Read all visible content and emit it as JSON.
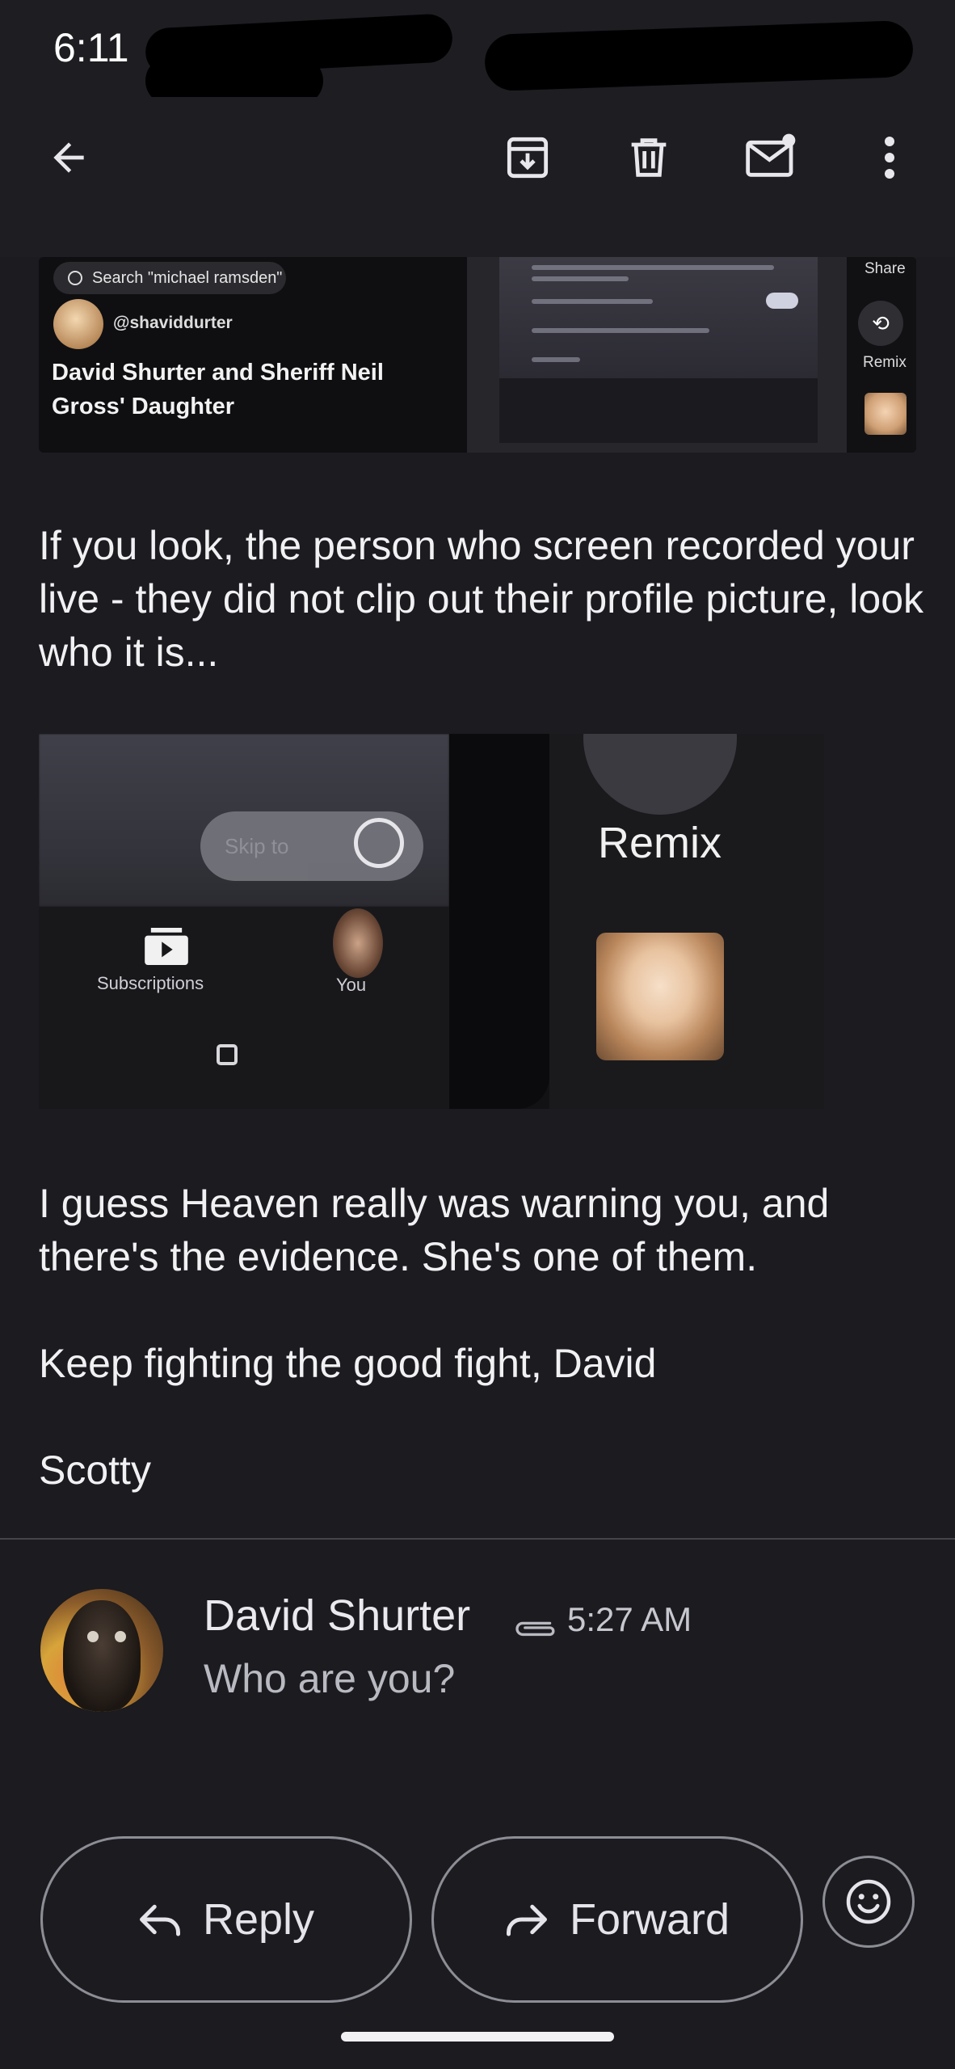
{
  "status_bar": {
    "time": "6:11"
  },
  "toolbar": {
    "back": "back-arrow-icon",
    "archive": "archive-icon",
    "delete": "trash-icon",
    "mark_unread": "mail-unread-icon",
    "more": "more-vertical-icon"
  },
  "embedded_screenshot_1": {
    "search_text": "Search \"michael ramsden\"",
    "handle": "@shaviddurter",
    "video_title": "David Shurter and Sheriff Neil Gross' Daughter",
    "share_label": "Share",
    "remix_label": "Remix"
  },
  "message": {
    "paragraph_1": "If you look, the person who screen recorded your live - they did not clip out their profile picture, look who it is...",
    "paragraph_2": "I guess Heaven really was warning you, and there's the evidence. She's one of them.",
    "paragraph_3": "Keep fighting the good fight, David",
    "signature": "Scotty"
  },
  "embedded_screenshot_2": {
    "skip_text": "Skip to",
    "subscriptions_label": "Subscriptions",
    "you_label": "You",
    "remix_label": "Remix"
  },
  "reply_item": {
    "sender": "David Shurter",
    "time": "5:27 AM",
    "snippet": "Who are you?",
    "has_attachment": true
  },
  "actions": {
    "reply_label": "Reply",
    "forward_label": "Forward",
    "emoji_icon": "emoji-reaction-icon"
  },
  "colors": {
    "background": "#1b1b20",
    "text": "#f1f1f3",
    "muted": "#b9b9c2",
    "outline": "#8d8d96"
  }
}
